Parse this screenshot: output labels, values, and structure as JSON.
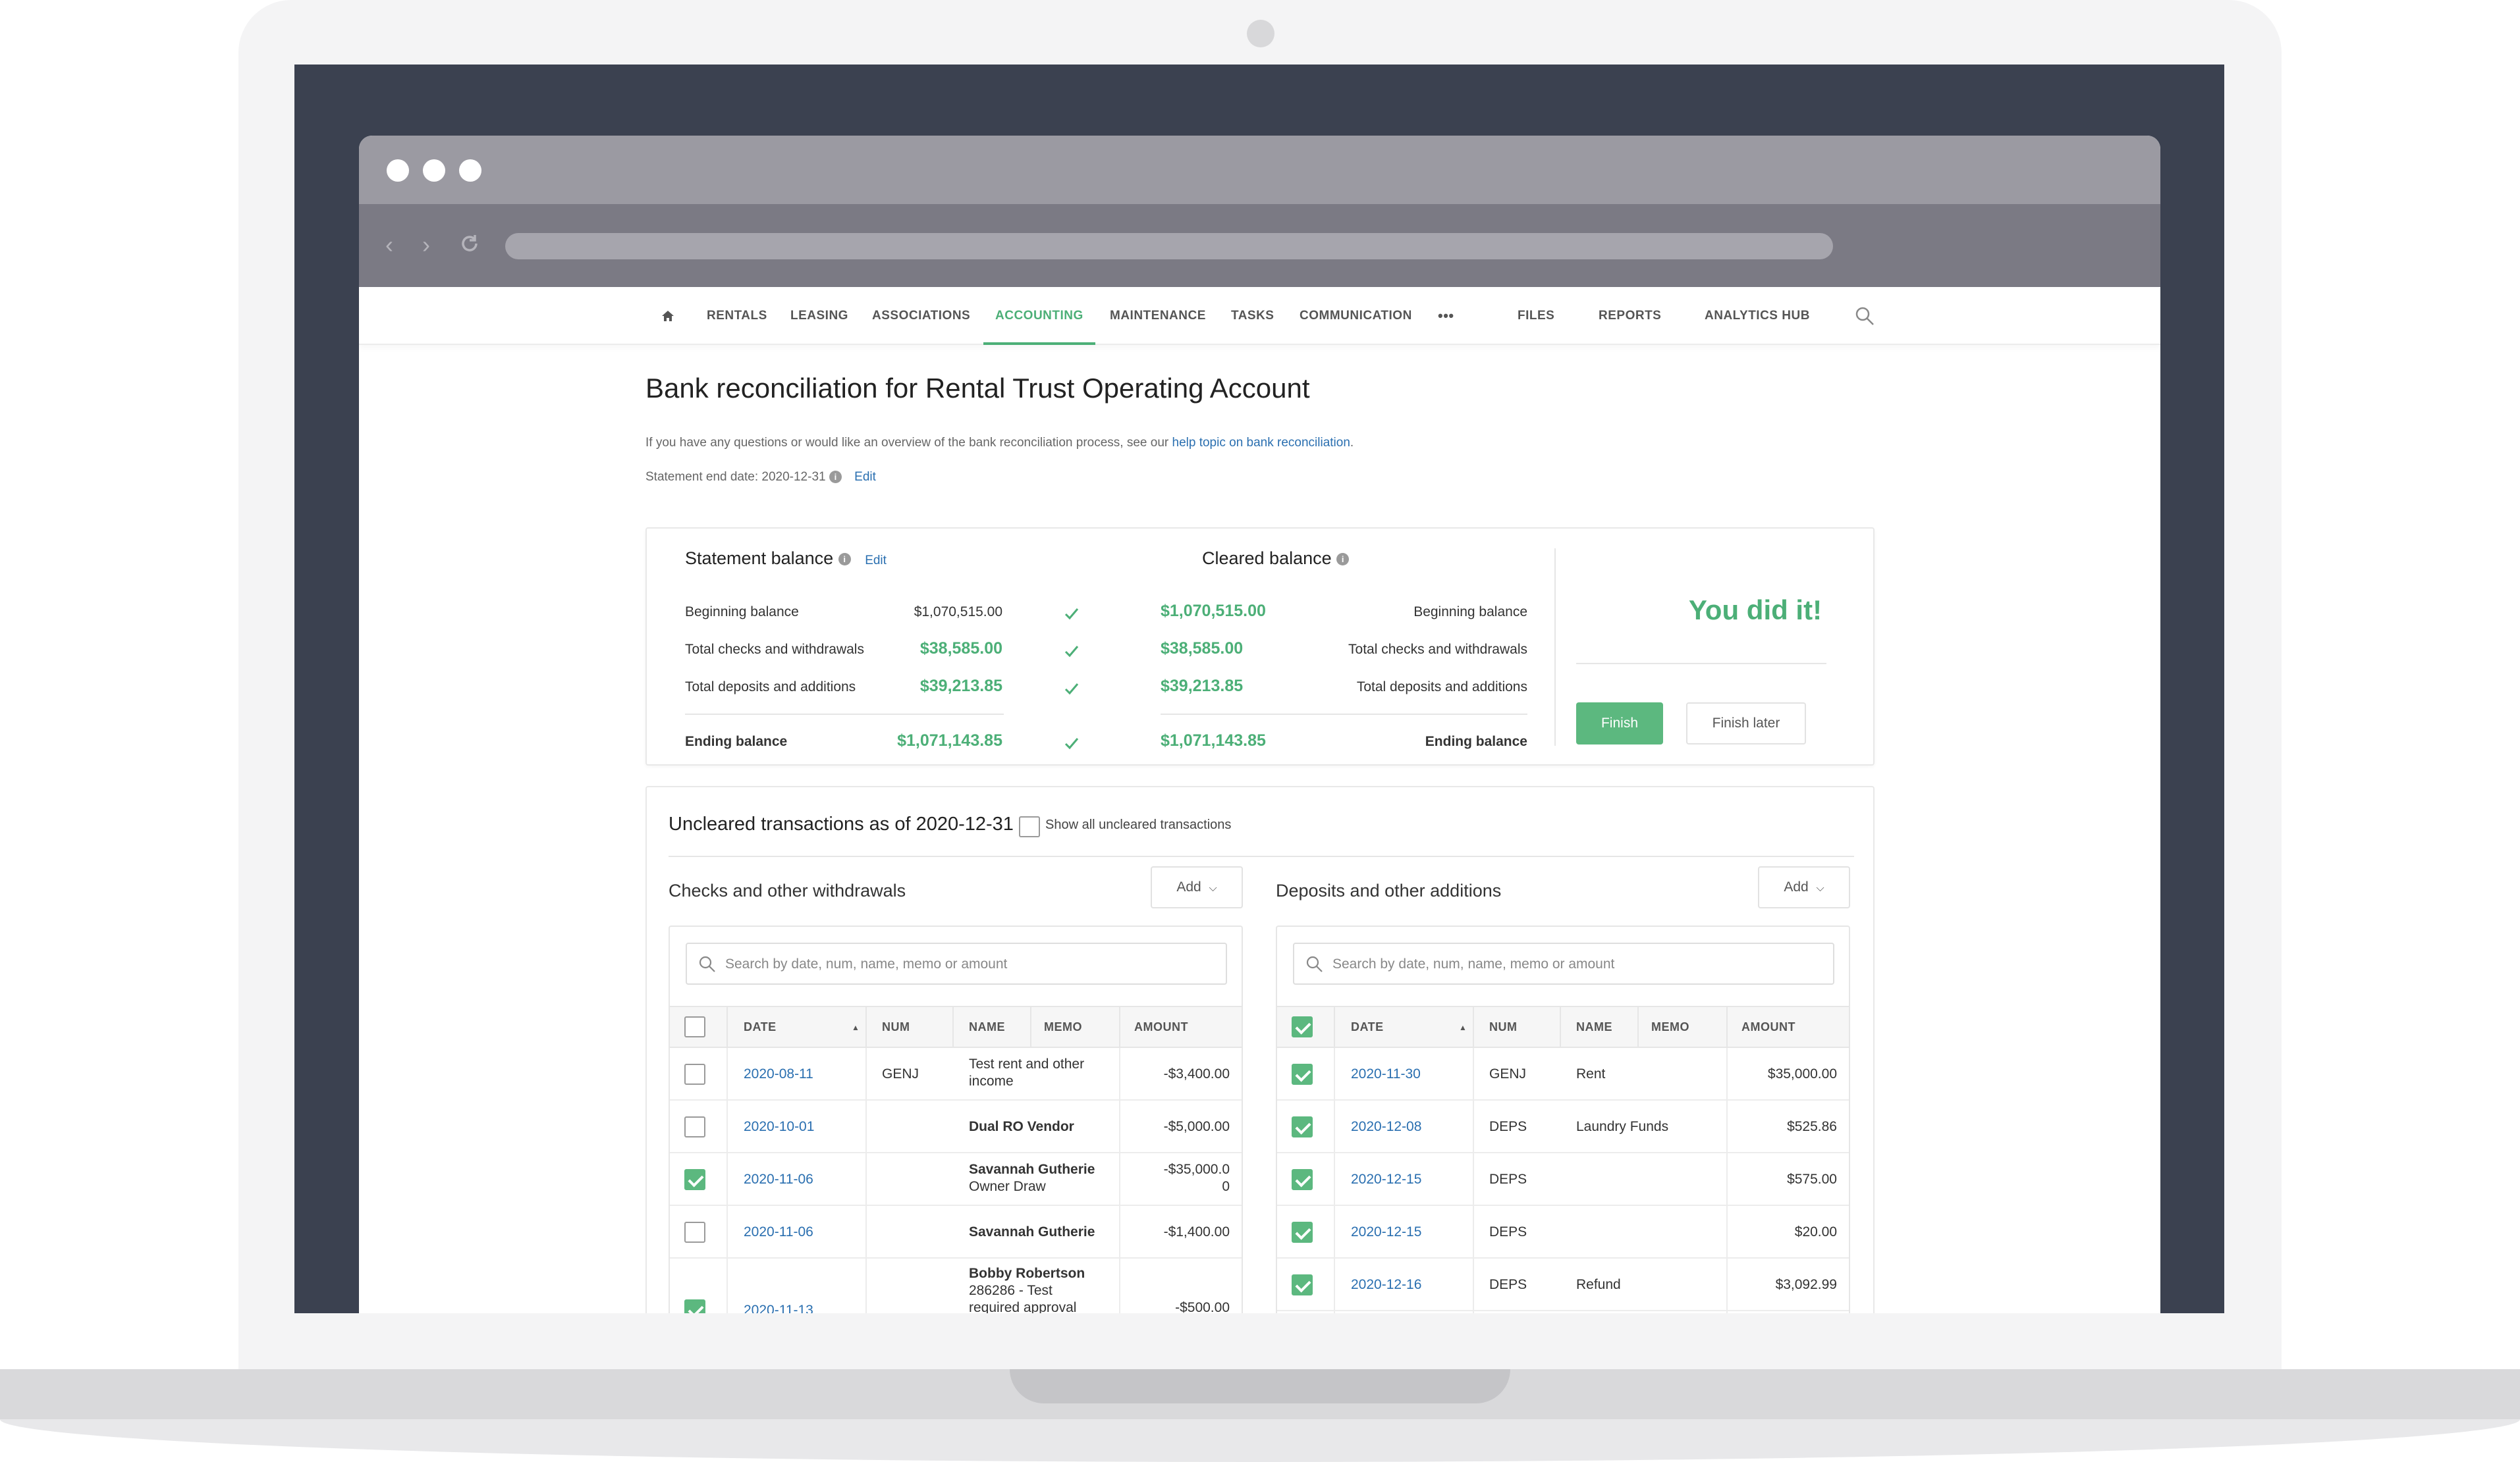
{
  "nav": {
    "items": [
      {
        "label": "RENTALS",
        "name": "nav-rentals"
      },
      {
        "label": "LEASING",
        "name": "nav-leasing"
      },
      {
        "label": "ASSOCIATIONS",
        "name": "nav-associations"
      },
      {
        "label": "ACCOUNTING",
        "name": "nav-accounting",
        "active": true
      },
      {
        "label": "MAINTENANCE",
        "name": "nav-maintenance"
      },
      {
        "label": "TASKS",
        "name": "nav-tasks"
      },
      {
        "label": "COMMUNICATION",
        "name": "nav-communication"
      },
      {
        "label": "•••",
        "name": "nav-more"
      },
      {
        "label": "FILES",
        "name": "nav-files"
      },
      {
        "label": "REPORTS",
        "name": "nav-reports"
      },
      {
        "label": "ANALYTICS HUB",
        "name": "nav-analytics-hub"
      }
    ],
    "icons": {
      "home": "home-icon",
      "search": "search-icon"
    }
  },
  "page": {
    "title": "Bank reconciliation for Rental Trust Operating Account",
    "intro_text": "If you have any questions or would like an overview of the bank reconciliation process, see our",
    "intro_link": "help topic on bank reconciliation",
    "intro_end": ".",
    "statement_end_label": "Statement end date: 2020-12-31",
    "edit_label": "Edit"
  },
  "summary": {
    "statement": {
      "title": "Statement balance",
      "edit_label": "Edit",
      "rows": [
        {
          "label": "Beginning balance",
          "value": "$1,070,515.00"
        },
        {
          "label": "Total checks and withdrawals",
          "value": "$38,585.00"
        },
        {
          "label": "Total deposits and additions",
          "value": "$39,213.85"
        },
        {
          "label": "Ending balance",
          "value": "$1,071,143.85"
        }
      ]
    },
    "cleared": {
      "title": "Cleared balance",
      "rows": [
        {
          "label": "Beginning balance",
          "value": "$1,070,515.00"
        },
        {
          "label": "Total checks and withdrawals",
          "value": "$38,585.00"
        },
        {
          "label": "Total deposits and additions",
          "value": "$39,213.85"
        },
        {
          "label": "Ending balance",
          "value": "$1,071,143.85"
        }
      ]
    },
    "success_message": "You did it!",
    "finish_label": "Finish",
    "finish_later_label": "Finish later",
    "colors": {
      "accent_green": "#4caf77",
      "link_blue": "#2a6fb0"
    }
  },
  "uncleared": {
    "title": "Uncleared transactions as of 2020-12-31",
    "show_all_label": "Show all uncleared transactions",
    "show_all_checked": false,
    "withdrawals": {
      "title": "Checks and other withdrawals",
      "add_label": "Add",
      "search_placeholder": "Search by date, num, name, memo or amount",
      "columns": [
        "DATE",
        "NUM",
        "NAME",
        "MEMO",
        "AMOUNT"
      ],
      "header_checked": false,
      "rows": [
        {
          "checked": false,
          "date": "2020-08-11",
          "num": "GENJ",
          "name_bold": "",
          "name_lines": [
            "Test rent and other",
            "income"
          ],
          "amount": "-$3,400.00"
        },
        {
          "checked": false,
          "date": "2020-10-01",
          "num": "",
          "name_bold": "Dual RO Vendor",
          "name_lines": [],
          "amount": "-$5,000.00"
        },
        {
          "checked": true,
          "date": "2020-11-06",
          "num": "",
          "name_bold": "Savannah Gutherie",
          "name_lines": [
            "Owner Draw"
          ],
          "amount": "-$35,000.0\n0"
        },
        {
          "checked": false,
          "date": "2020-11-06",
          "num": "",
          "name_bold": "Savannah Gutherie",
          "name_lines": [],
          "amount": "-$1,400.00"
        },
        {
          "checked": true,
          "date": "2020-11-13",
          "num": "",
          "name_bold": "Bobby Robertson",
          "name_lines": [
            "286286 - Test",
            "required approval"
          ],
          "amount": "-$500.00"
        }
      ]
    },
    "deposits": {
      "title": "Deposits and other additions",
      "add_label": "Add",
      "search_placeholder": "Search by date, num, name, memo or amount",
      "columns": [
        "DATE",
        "NUM",
        "NAME",
        "MEMO",
        "AMOUNT"
      ],
      "header_checked": true,
      "rows": [
        {
          "checked": true,
          "date": "2020-11-30",
          "num": "GENJ",
          "name": "Rent",
          "amount": "$35,000.00"
        },
        {
          "checked": true,
          "date": "2020-12-08",
          "num": "DEPS",
          "name": "Laundry Funds",
          "amount": "$525.86"
        },
        {
          "checked": true,
          "date": "2020-12-15",
          "num": "DEPS",
          "name": "",
          "amount": "$575.00"
        },
        {
          "checked": true,
          "date": "2020-12-15",
          "num": "DEPS",
          "name": "",
          "amount": "$20.00"
        },
        {
          "checked": true,
          "date": "2020-12-16",
          "num": "DEPS",
          "name": "Refund",
          "amount": "$3,092.99"
        }
      ]
    }
  }
}
